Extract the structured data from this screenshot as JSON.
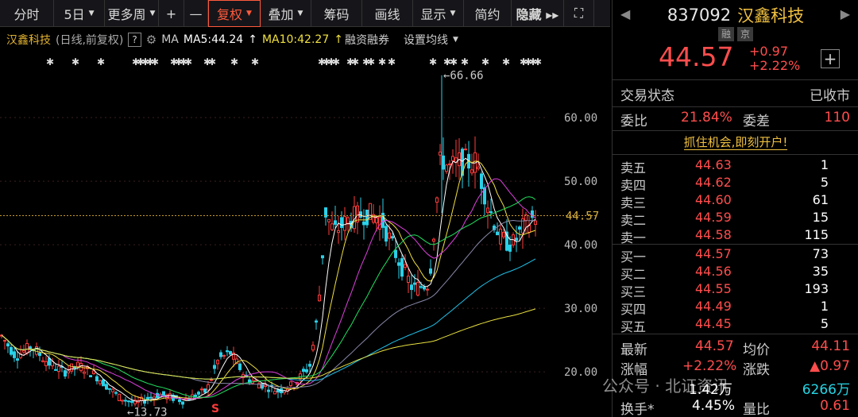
{
  "toolbar": {
    "items": [
      {
        "label": "分时"
      },
      {
        "label": "5日",
        "caret": "▼"
      },
      {
        "label": "更多周",
        "caret": "▼"
      },
      {
        "label": "+"
      },
      {
        "label": "—"
      },
      {
        "label": "复权",
        "caret": "▼",
        "active": true
      },
      {
        "label": "叠加",
        "caret": "▼"
      },
      {
        "label": "筹码"
      },
      {
        "label": "画线"
      },
      {
        "label": "显示",
        "caret": "▼"
      },
      {
        "label": "简约"
      },
      {
        "label": "隐藏 ▸▸"
      },
      {
        "label": "⛶"
      }
    ]
  },
  "info": {
    "stock_name": "汉鑫科技",
    "period": "(日线,前复权)",
    "help": "?",
    "ma_label": "MA",
    "ma5": "MA5:44.24",
    "ma10": "MA10:42.27",
    "arrow": "↑",
    "rzrq": "融资融券",
    "set_ma": "设置均线"
  },
  "chart_data": {
    "type": "candlestick",
    "y_ticks": [
      "60.00",
      "50.00",
      "40.00",
      "30.00",
      "20.00"
    ],
    "y_tick_values": [
      60,
      50,
      40,
      30,
      20
    ],
    "ylim": [
      12.9,
      70.5
    ],
    "current_price_label": "44.57",
    "current_price": 44.57,
    "high_annotation": "66.66",
    "high_value": 66.66,
    "low_annotation": "13.73",
    "low_value": 13.73,
    "marker": "S",
    "ma_lines": [
      {
        "color": "#ffffff"
      },
      {
        "color": "#f0e040"
      },
      {
        "color": "#e040e0"
      },
      {
        "color": "#20e060"
      },
      {
        "color": "#8888aa"
      },
      {
        "color": "#20c0e8"
      },
      {
        "color": "#e8e040"
      }
    ],
    "colors": {
      "up": "#ff3b3b",
      "down": "#2ad0e8",
      "price_line": "#c89a2e"
    }
  },
  "panel": {
    "code": "837092",
    "name": "汉鑫科技",
    "tags": [
      "融",
      "京"
    ],
    "price": "44.57",
    "change": "+0.97",
    "change_pct": "+2.22%",
    "plus": "+",
    "status_label": "交易状态",
    "status_value": "已收市",
    "weibi_label": "委比",
    "weibi_value": "21.84%",
    "weicha_label": "委差",
    "weicha_value": "110",
    "open_account": "抓住机会,即刻开户!",
    "asks": [
      {
        "label": "卖五",
        "price": "44.63",
        "vol": "1"
      },
      {
        "label": "卖四",
        "price": "44.62",
        "vol": "5"
      },
      {
        "label": "卖三",
        "price": "44.60",
        "vol": "61"
      },
      {
        "label": "卖二",
        "price": "44.59",
        "vol": "15"
      },
      {
        "label": "卖一",
        "price": "44.58",
        "vol": "115"
      }
    ],
    "bids": [
      {
        "label": "买一",
        "price": "44.57",
        "vol": "73"
      },
      {
        "label": "买二",
        "price": "44.56",
        "vol": "35"
      },
      {
        "label": "买三",
        "price": "44.55",
        "vol": "193"
      },
      {
        "label": "买四",
        "price": "44.49",
        "vol": "1"
      },
      {
        "label": "买五",
        "price": "44.45",
        "vol": "5"
      }
    ],
    "latest_label": "最新",
    "latest_value": "44.57",
    "avg_label": "均价",
    "avg_value": "44.11",
    "zf_label": "涨幅",
    "zf_value": "+2.22%",
    "zd_label": "涨跌",
    "zd_value": "▲0.97",
    "vol_value": "1.42万",
    "amt_value": "6266万",
    "hs_label": "换手*",
    "hs_value": "4.45%",
    "lb_label": "量比",
    "lb_value": "0.61"
  },
  "watermark": "公众号 · 北证资讯"
}
